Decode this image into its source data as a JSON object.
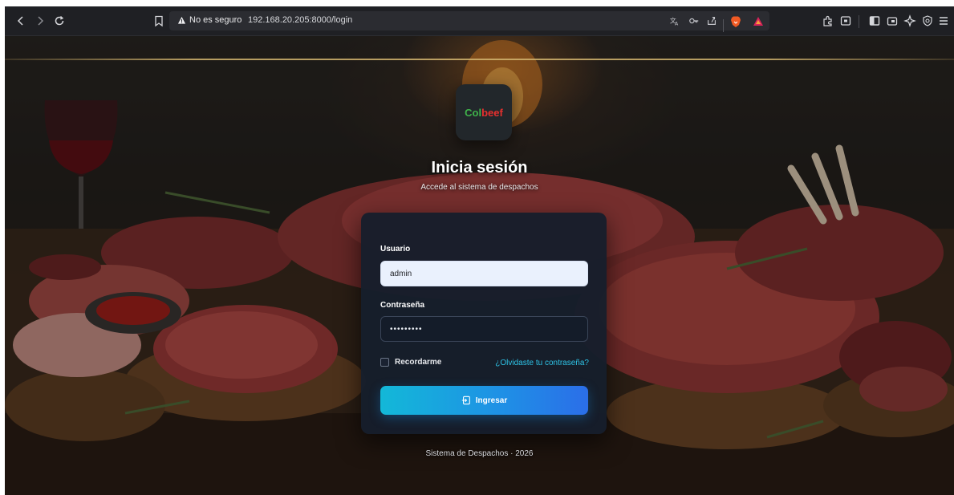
{
  "browser": {
    "security_label": "No es seguro",
    "url": "192.168.20.205:8000/login"
  },
  "login": {
    "brand_col": "Col",
    "brand_beef": "beef",
    "title": "Inicia sesión",
    "subtitle": "Accede al sistema de despachos",
    "username_label": "Usuario",
    "username_value": "admin",
    "password_label": "Contraseña",
    "password_value": "•••••••••",
    "remember_label": "Recordarme",
    "forgot_link": "¿Olvidaste tu contraseña?",
    "submit_label": "Ingresar",
    "footer": "Sistema de Despachos · 2026"
  },
  "colors": {
    "brand_green": "#3fb24a",
    "brand_red": "#e5302e",
    "accent_cyan": "#13b8d8",
    "accent_blue": "#2b6ee8",
    "link": "#2ec3e6"
  }
}
